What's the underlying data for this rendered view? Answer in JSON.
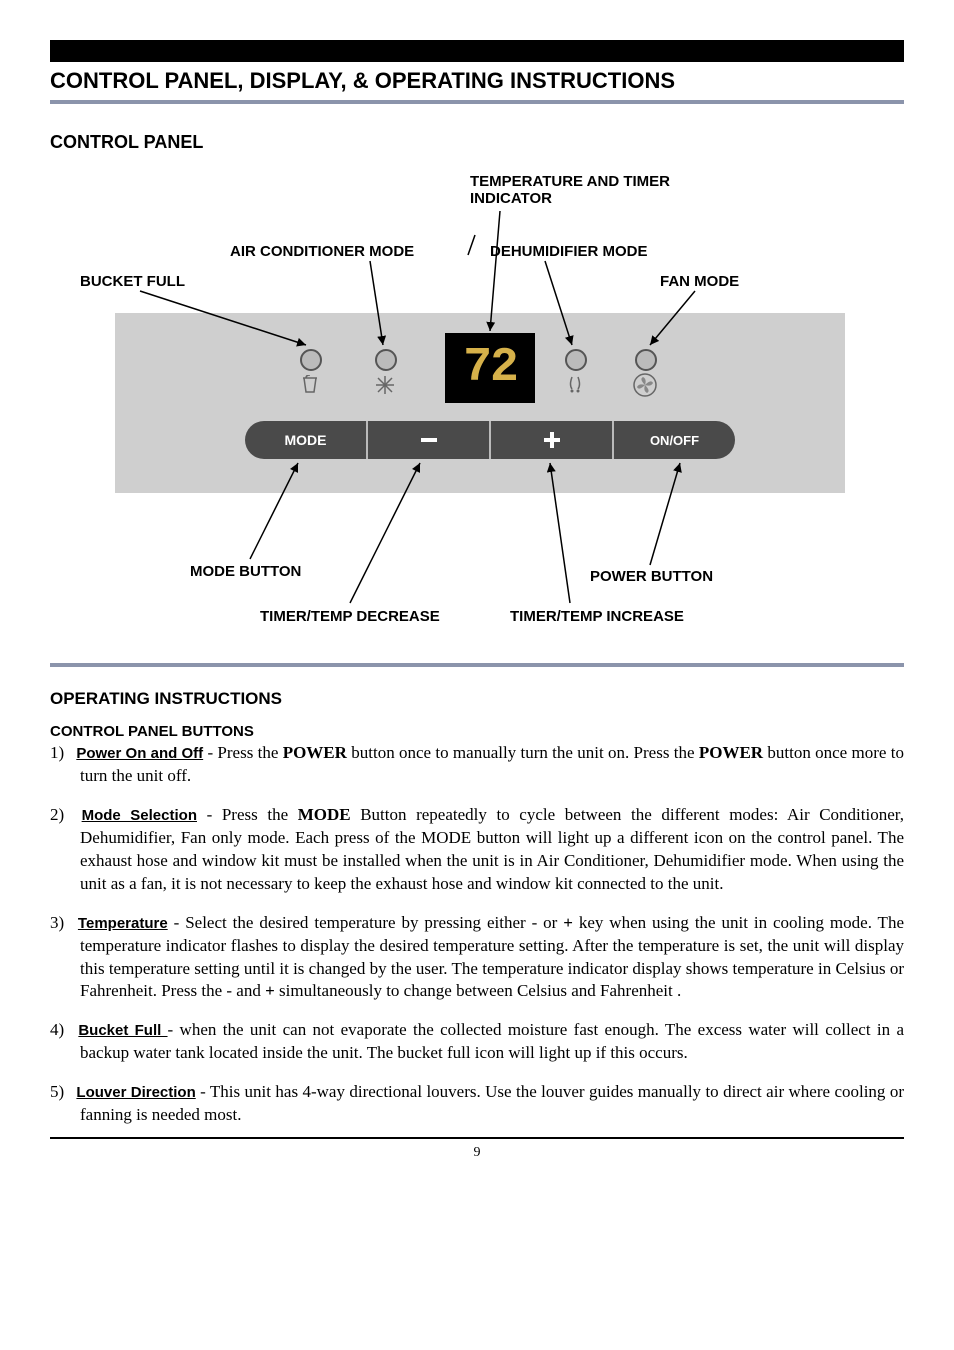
{
  "header": {
    "title": "CONTROL PANEL, DISPLAY, & OPERATING INSTRUCTIONS"
  },
  "section1": {
    "title": "CONTROL PANEL"
  },
  "diagram": {
    "temp_timer": "TEMPERATURE AND TIMER INDICATOR",
    "ac_mode": "AIR CONDITIONER MODE",
    "dehum_mode": "DEHUMIDIFIER MODE",
    "bucket_full": "BUCKET FULL",
    "fan_mode": "FAN MODE",
    "mode_button": "MODE BUTTON",
    "power_button": "POWER BUTTON",
    "timer_dec": "TIMER/TEMP DECREASE",
    "timer_inc": "TIMER/TEMP INCREASE",
    "display_value": "72",
    "btn_mode": "MODE",
    "btn_onoff": "ON/OFF"
  },
  "section2": {
    "title": "OPERATING INSTRUCTIONS",
    "subtitle": "CONTROL PANEL BUTTONS"
  },
  "items": [
    {
      "num": "1)",
      "name": "Power On and Off",
      "text_a": " - Press the ",
      "bold_a": "POWER",
      "text_b": " button once to manually turn the unit on. Press the ",
      "bold_b": "POWER",
      "text_c": " button once more to turn the unit off."
    },
    {
      "num": "2)",
      "name": "Mode Selection",
      "text_a": " - Press the ",
      "bold_a": "MODE",
      "text_b": " Button repeatedly to cycle between the different modes:  Air Conditioner, Dehumidifier, Fan only mode. Each press of the MODE button will light up a different icon on the control panel. The exhaust hose and window kit must be installed when the unit is in Air Conditioner, Dehumidifier mode. When using the unit as a fan, it is not necessary to keep the exhaust hose and window kit connected to the unit."
    },
    {
      "num": "3)",
      "name": "Temperature",
      "text_a": " - Select the desired temperature by pressing either - or ",
      "bold_a": "+",
      "text_b": " key when using the unit in cooling mode. The temperature indicator flashes to display the desired temperature setting. After the temperature is set, the unit will display this temperature setting until it is changed by the user. The temperature indicator display shows temperature in Celsius or Fahrenheit.  Press the - and ",
      "bold_b": "+",
      "text_c": " simultaneously to change between Celsius and Fahrenheit ."
    },
    {
      "num": "4)",
      "name": "Bucket Full ",
      "text_a": "- when the unit can not evaporate the collected moisture fast enough. The excess water will collect in a backup water tank located inside the unit. The bucket full  icon  will  light  up  if  this occurs."
    },
    {
      "num": "5)",
      "name": "Louver Direction",
      "text_a": " - This unit has 4-way directional louvers. Use the louver guides manually to direct air where cooling or fanning is needed most."
    }
  ],
  "page_number": "9"
}
